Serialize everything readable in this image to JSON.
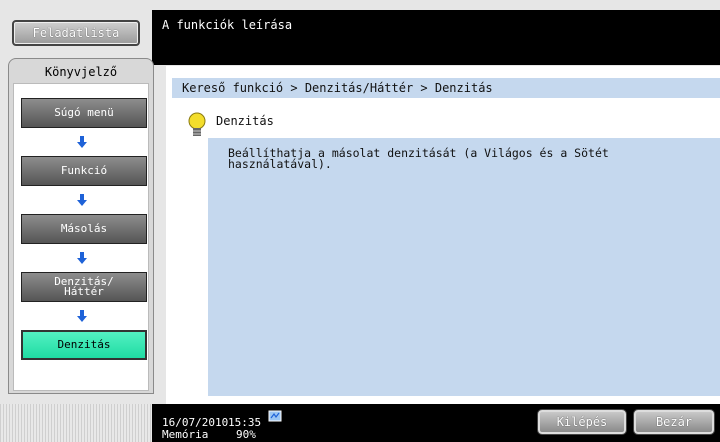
{
  "header": {
    "task_list_label": "Feladatlista",
    "title": "A funkciók leírása"
  },
  "sidebar": {
    "tab_title": "Könyvjelző",
    "steps": [
      {
        "label": "Súgó menü",
        "active": false
      },
      {
        "label": "Funkció",
        "active": false
      },
      {
        "label": "Másolás",
        "active": false
      },
      {
        "label": "Denzitás/\nHáttér",
        "active": false
      },
      {
        "label": "Denzitás",
        "active": true
      }
    ]
  },
  "main": {
    "breadcrumb": "Kereső funkció > Denzitás/Háttér > Denzitás",
    "subtitle": "Denzitás",
    "description": "Beállíthatja a másolat denzitását (a Világos és a Sötét\nhasználatával)."
  },
  "status": {
    "date": "16/07/2010",
    "time": "15:35",
    "memory_label": "Memória",
    "memory_value": "90%",
    "exit_label": "Kilépés",
    "close_label": "Bezár"
  },
  "colors": {
    "active_step": "#1fdca3",
    "panel_blue": "#c5d8ee",
    "arrow_blue": "#1e62d8"
  }
}
